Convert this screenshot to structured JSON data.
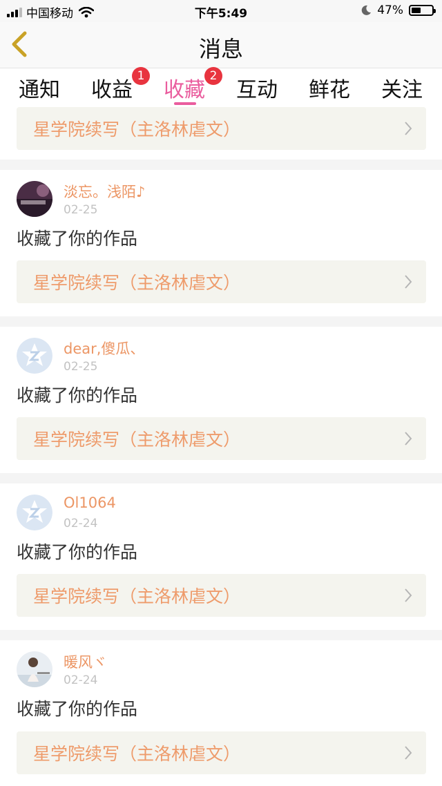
{
  "status_bar": {
    "carrier": "中国移动",
    "time": "下午5:49",
    "battery": "47%",
    "battery_level": 0.47
  },
  "nav": {
    "title": "消息"
  },
  "tabs": [
    {
      "label": "通知",
      "badge": ""
    },
    {
      "label": "收益",
      "badge": "1"
    },
    {
      "label": "收藏",
      "badge": "2",
      "active": true
    },
    {
      "label": "互动",
      "badge": ""
    },
    {
      "label": "鲜花",
      "badge": ""
    },
    {
      "label": "关注",
      "badge": ""
    }
  ],
  "messages": [
    {
      "username": "",
      "date": "",
      "action": "",
      "work_title": "星学院续写（主洛林虐文）",
      "avatar": "none"
    },
    {
      "username": "淡忘。浅陌♪",
      "date": "02-25",
      "action": "收藏了你的作品",
      "work_title": "星学院续写（主洛林虐文）",
      "avatar": "photo-dark"
    },
    {
      "username": "dear,傻瓜、",
      "date": "02-25",
      "action": "收藏了你的作品",
      "work_title": "星学院续写（主洛林虐文）",
      "avatar": "default-star"
    },
    {
      "username": "Ol1064",
      "date": "02-24",
      "action": "收藏了你的作品",
      "work_title": "星学院续写（主洛林虐文）",
      "avatar": "default-star"
    },
    {
      "username": "暖风ヾ",
      "date": "02-24",
      "action": "收藏了你的作品",
      "work_title": "星学院续写（主洛林虐文）",
      "avatar": "photo-light"
    }
  ],
  "colors": {
    "accent": "#ea5d9e",
    "username": "#ec9665",
    "work_title": "#ee9b6b",
    "badge": "#e8343f",
    "back_arrow": "#c9a227"
  }
}
